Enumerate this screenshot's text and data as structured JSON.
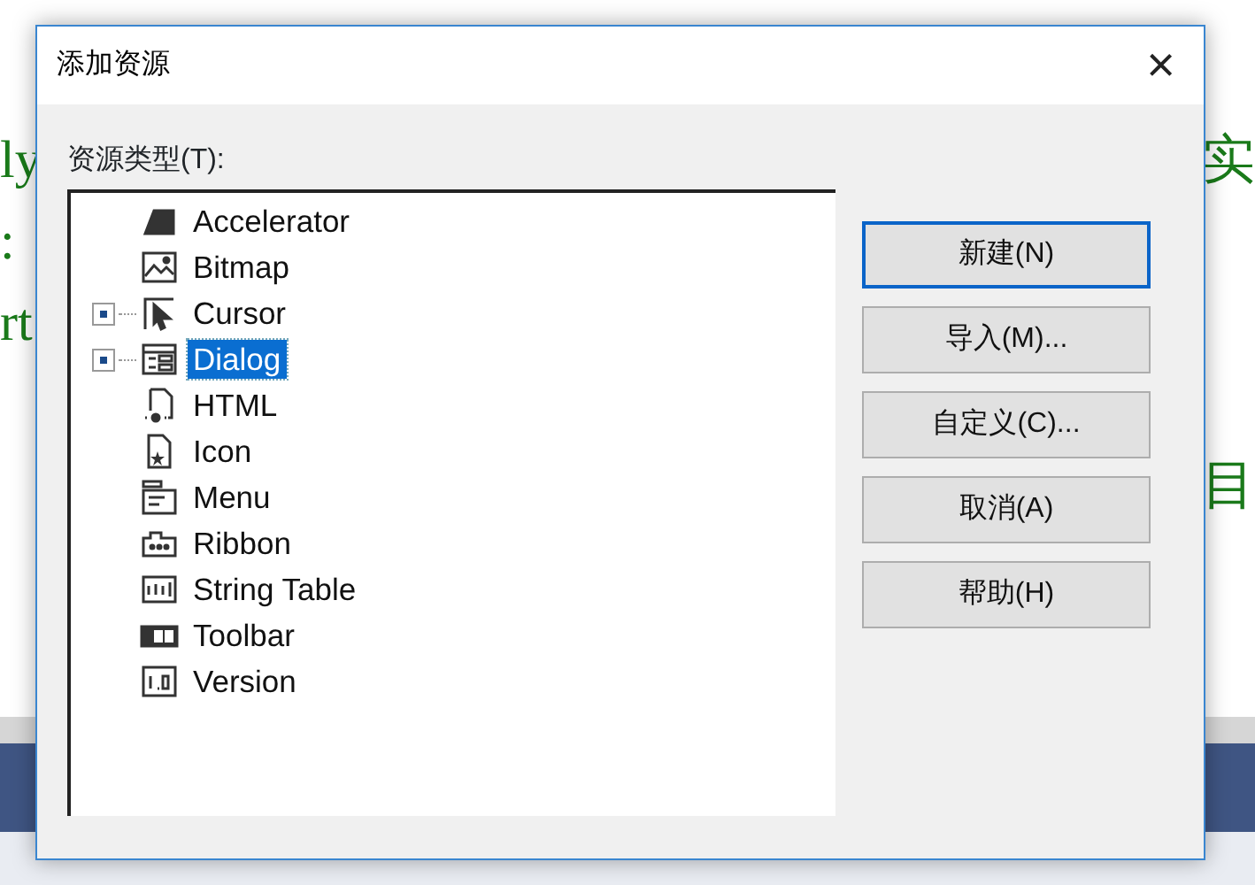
{
  "background": {
    "upper_lines": [
      {
        "left": "ly",
        "right": "实"
      },
      {
        "left": ":"
      },
      {
        "left": "rt"
      }
    ],
    "lower_lines": [
      {
        "right": "目"
      }
    ]
  },
  "dialog": {
    "title": "添加资源",
    "close": "×",
    "tree_label": "资源类型(T):",
    "tree": [
      {
        "label": "Accelerator",
        "kind": "accelerator",
        "expandable": false,
        "selected": false
      },
      {
        "label": "Bitmap",
        "kind": "bitmap",
        "expandable": false,
        "selected": false
      },
      {
        "label": "Cursor",
        "kind": "cursor",
        "expandable": true,
        "selected": false
      },
      {
        "label": "Dialog",
        "kind": "dialog",
        "expandable": true,
        "selected": true
      },
      {
        "label": "HTML",
        "kind": "html",
        "expandable": false,
        "selected": false
      },
      {
        "label": "Icon",
        "kind": "icon",
        "expandable": false,
        "selected": false
      },
      {
        "label": "Menu",
        "kind": "menu",
        "expandable": false,
        "selected": false
      },
      {
        "label": "Ribbon",
        "kind": "ribbon",
        "expandable": false,
        "selected": false
      },
      {
        "label": "String Table",
        "kind": "string",
        "expandable": false,
        "selected": false
      },
      {
        "label": "Toolbar",
        "kind": "toolbar",
        "expandable": false,
        "selected": false
      },
      {
        "label": "Version",
        "kind": "version",
        "expandable": false,
        "selected": false
      }
    ],
    "buttons": [
      {
        "label": "新建(N)",
        "default": true
      },
      {
        "label": "导入(M)...",
        "default": false
      },
      {
        "label": "自定义(C)...",
        "default": false
      },
      {
        "label": "取消(A)",
        "default": false
      },
      {
        "label": "帮助(H)",
        "default": false
      }
    ]
  }
}
